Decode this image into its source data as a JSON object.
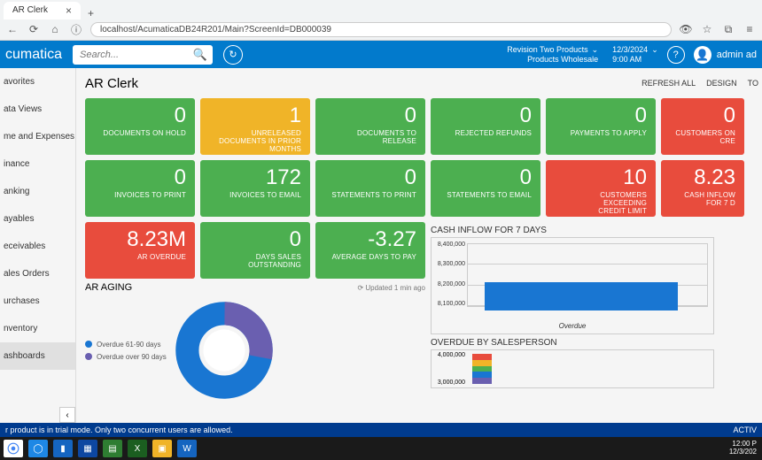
{
  "browser": {
    "tab_title": "AR Clerk",
    "url": "localhost/AcumaticaDB24R201/Main?ScreenId=DB000039"
  },
  "topbar": {
    "brand": "cumatica",
    "search_placeholder": "Search...",
    "business_name": "Revision Two Products",
    "business_sub": "Products Wholesale",
    "date": "12/3/2024",
    "time": "9:00 AM",
    "user": "admin ad"
  },
  "sidebar": {
    "items": [
      "avorites",
      "ata Views",
      "me and Expenses",
      "inance",
      "anking",
      "ayables",
      "eceivables",
      "ales Orders",
      "urchases",
      "nventory",
      "ashboards"
    ],
    "active_index": 10
  },
  "page_title": "AR Clerk",
  "actions": {
    "refresh": "REFRESH ALL",
    "design": "DESIGN",
    "tools": "TO"
  },
  "kpis_row1": [
    {
      "value": "0",
      "label": "DOCUMENTS ON HOLD",
      "color": "c-green",
      "w": 124
    },
    {
      "value": "1",
      "label": "UNRELEASED\nDOCUMENTS IN PRIOR\nMONTHS",
      "color": "c-yellow",
      "w": 124
    },
    {
      "value": "0",
      "label": "DOCUMENTS TO RELEASE",
      "color": "c-green",
      "w": 124
    },
    {
      "value": "0",
      "label": "REJECTED REFUNDS",
      "color": "c-green",
      "w": 124
    },
    {
      "value": "0",
      "label": "PAYMENTS TO APPLY",
      "color": "c-green",
      "w": 124
    },
    {
      "value": "0",
      "label": "CUSTOMERS ON CRE",
      "color": "c-red",
      "w": 94
    }
  ],
  "kpis_row2": [
    {
      "value": "0",
      "label": "INVOICES TO PRINT",
      "color": "c-green",
      "w": 124
    },
    {
      "value": "172",
      "label": "INVOICES TO EMAIL",
      "color": "c-green",
      "w": 124
    },
    {
      "value": "0",
      "label": "STATEMENTS TO PRINT",
      "color": "c-green",
      "w": 124
    },
    {
      "value": "0",
      "label": "STATEMENTS TO EMAIL",
      "color": "c-green",
      "w": 124
    },
    {
      "value": "10",
      "label": "CUSTOMERS EXCEEDING\nCREDIT LIMIT",
      "color": "c-red",
      "w": 124
    },
    {
      "value": "8.23",
      "label": "CASH INFLOW FOR 7 D",
      "color": "c-red",
      "w": 94
    }
  ],
  "kpis_row3": [
    {
      "value": "8.23M",
      "label": "AR OVERDUE",
      "color": "c-red",
      "w": 124
    },
    {
      "value": "0",
      "label": "DAYS SALES\nOUTSTANDING",
      "color": "c-green",
      "w": 124
    },
    {
      "value": "-3.27",
      "label": "AVERAGE DAYS TO PAY",
      "color": "c-green",
      "w": 124
    }
  ],
  "aging": {
    "title": "AR AGING",
    "updated": "Updated 1 min ago",
    "legend": [
      {
        "label": "Overdue 61-90 days",
        "color": "#1976d2"
      },
      {
        "label": "Overdue over 90 days",
        "color": "#6a5fb0"
      }
    ]
  },
  "cashinflow": {
    "title": "CASH INFLOW FOR 7 DAYS",
    "ylabels": [
      "8,400,000",
      "8,300,000",
      "8,200,000",
      "8,100,000"
    ],
    "xlabel": "Overdue"
  },
  "overdue_sp": {
    "title": "OVERDUE BY SALESPERSON",
    "ylabels": [
      "4,000,000",
      "3,000,000"
    ],
    "stack_colors": [
      "#e84c3d",
      "#f0b428",
      "#4caf50",
      "#1976d2",
      "#6a5fb0"
    ]
  },
  "trial": {
    "left": "r product is in trial mode. Only two concurrent users are allowed.",
    "right": "ACTIV"
  },
  "taskbar": {
    "apps": [
      {
        "bg": "#fff",
        "txt": "",
        "chrome": true
      },
      {
        "bg": "#1e88e5",
        "txt": "◯"
      },
      {
        "bg": "#1565c0",
        "txt": "▮"
      },
      {
        "bg": "#0d47a1",
        "txt": "▦"
      },
      {
        "bg": "#2e7d32",
        "txt": "▤"
      },
      {
        "bg": "#1b5e20",
        "txt": "X"
      },
      {
        "bg": "#f0b428",
        "txt": "▣"
      },
      {
        "bg": "#1565c0",
        "txt": "W"
      }
    ],
    "time": "12:00 P",
    "date": "12/3/202"
  },
  "chart_data": [
    {
      "type": "pie",
      "title": "AR AGING",
      "series": [
        {
          "name": "Overdue 61-90 days",
          "value": 72,
          "color": "#1976d2"
        },
        {
          "name": "Overdue over 90 days",
          "value": 28,
          "color": "#6a5fb0"
        }
      ]
    },
    {
      "type": "bar",
      "title": "CASH INFLOW FOR 7 DAYS",
      "categories": [
        "Overdue"
      ],
      "values": [
        8230000
      ],
      "ylim": [
        8100000,
        8400000
      ]
    },
    {
      "type": "bar",
      "title": "OVERDUE BY SALESPERSON",
      "categories": [
        ""
      ],
      "ylim": [
        3000000,
        4000000
      ],
      "series": [
        {
          "name": "segment1",
          "values": [
            800000
          ],
          "color": "#e84c3d"
        },
        {
          "name": "segment2",
          "values": [
            800000
          ],
          "color": "#f0b428"
        },
        {
          "name": "segment3",
          "values": [
            800000
          ],
          "color": "#4caf50"
        },
        {
          "name": "segment4",
          "values": [
            800000
          ],
          "color": "#1976d2"
        },
        {
          "name": "segment5",
          "values": [
            800000
          ],
          "color": "#6a5fb0"
        }
      ]
    }
  ]
}
